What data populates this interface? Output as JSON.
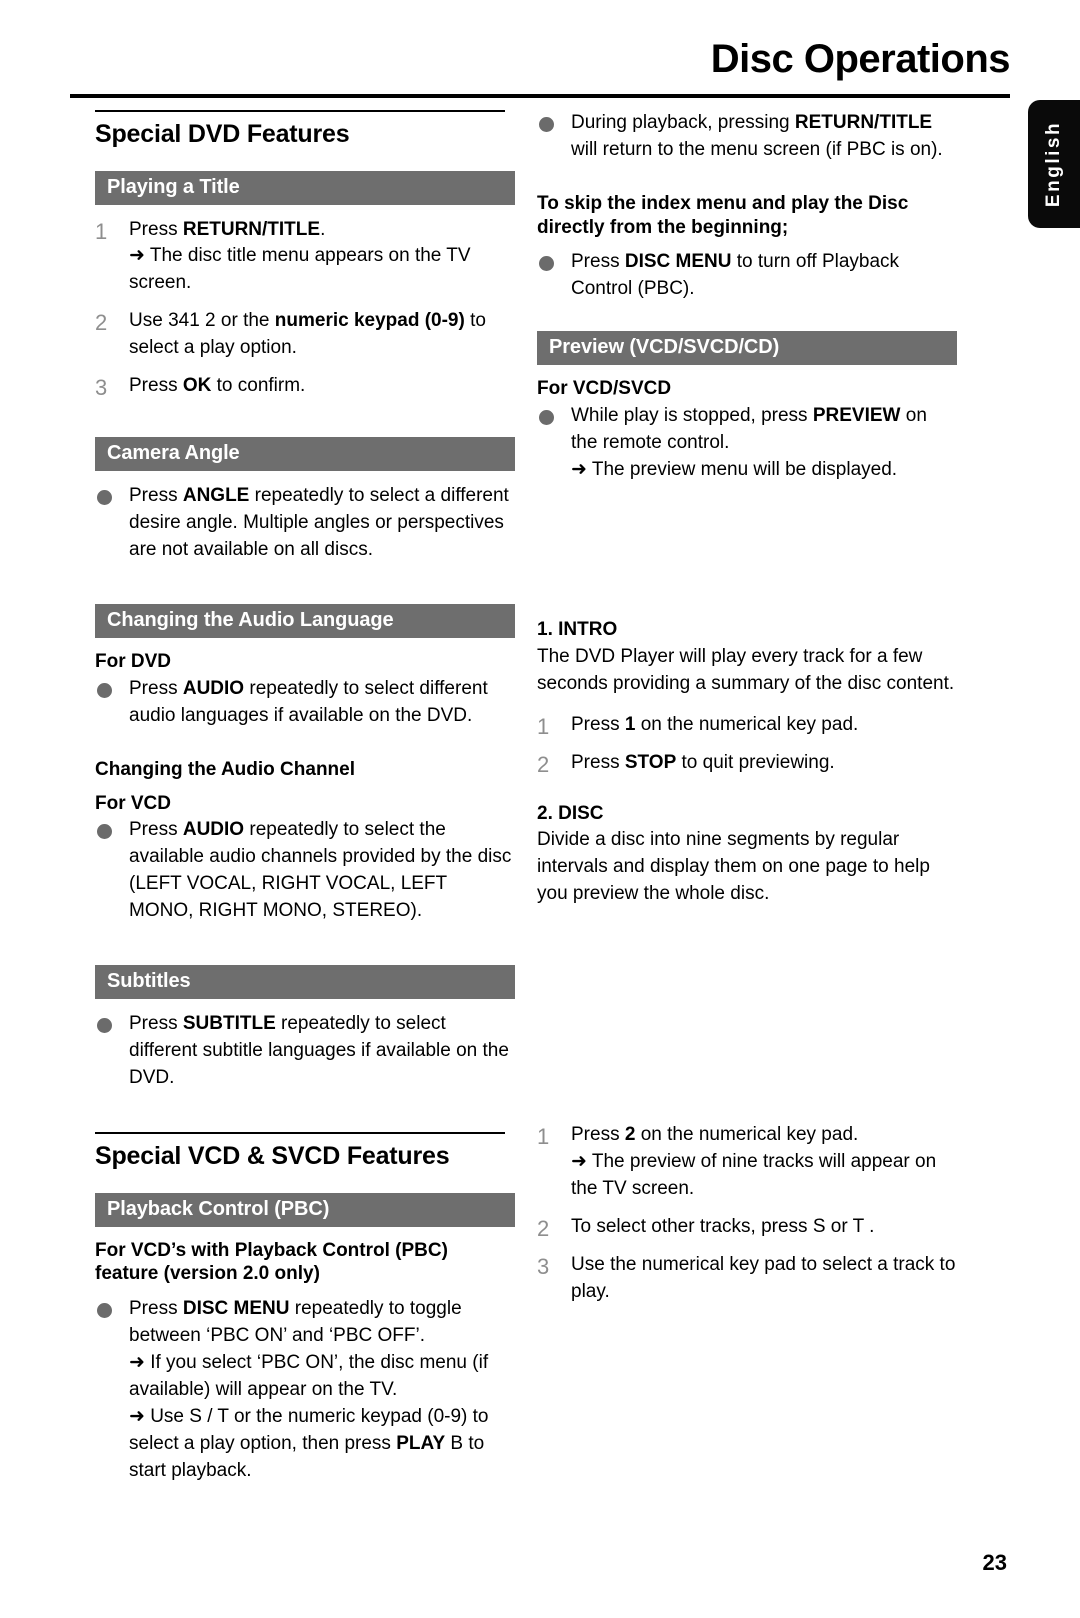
{
  "header": {
    "title": "Disc Operations"
  },
  "language_tab": {
    "label": "English"
  },
  "page_number": "23",
  "left_column": {
    "section_title": "Special DVD Features",
    "playing_a_title": {
      "band": "Playing a Title",
      "steps": [
        {
          "num": "1",
          "line1_pre": "Press ",
          "line1_bold": "RETURN/TITLE",
          "line1_post": ".",
          "arrow": "➜ The disc title menu appears on the TV screen."
        },
        {
          "num": "2",
          "line1_pre": "Use 341 2    or the ",
          "line1_bold": "numeric keypad (0-9)",
          "line1_post": " to select a play option."
        },
        {
          "num": "3",
          "line1_pre": "Press ",
          "line1_bold": "OK",
          "line1_post": " to confirm."
        }
      ]
    },
    "camera_angle": {
      "band": "Camera Angle",
      "bullet_pre": "Press ",
      "bullet_bold": "ANGLE",
      "bullet_post": " repeatedly to select a different desire angle. Multiple angles or perspectives are not available on all discs."
    },
    "audio_language": {
      "band": "Changing the Audio Language",
      "subhead": "For DVD",
      "bullet_pre": "Press ",
      "bullet_bold": "AUDIO",
      "bullet_post": " repeatedly to select different audio languages if available on the DVD."
    },
    "audio_channel": {
      "heading": "Changing the Audio Channel",
      "subhead": "For VCD",
      "bullet_pre": "Press ",
      "bullet_bold": "AUDIO",
      "bullet_post": " repeatedly to select the available audio channels provided by the disc (LEFT VOCAL, RIGHT VOCAL, LEFT MONO, RIGHT MONO, STEREO)."
    },
    "subtitles": {
      "band": "Subtitles",
      "bullet_pre": "Press ",
      "bullet_bold": "SUBTITLE",
      "bullet_post": " repeatedly to select different subtitle languages if available on the DVD."
    },
    "vcd_section_title": "Special VCD & SVCD Features",
    "playback_control": {
      "band": "Playback Control (PBC)",
      "subhead": "For VCD’s with Playback Control (PBC) feature (version 2.0 only)",
      "bullet_pre": "Press ",
      "bullet_bold": "DISC MENU",
      "bullet_post": " repeatedly to toggle between ‘PBC ON’ and ‘PBC OFF’.",
      "arrow1": "➜ If you select ‘PBC ON’, the disc menu (if available) will appear on the TV.",
      "arrow2_pre": "➜ Use S    / T    or the numeric keypad (0-9) to select a play option, then press ",
      "arrow2_bold": "PLAY",
      "arrow2_post": " B  to start playback."
    }
  },
  "right_column": {
    "return_title_bullet": {
      "pre": "During playback, pressing ",
      "bold1": "RETURN/TITLE",
      "post": " will return to the menu screen (if PBC is on)."
    },
    "skip_index": {
      "heading": "To skip the index menu and play the Disc directly from the beginning;",
      "bullet_pre": "Press ",
      "bullet_bold": "DISC MENU",
      "bullet_post": " to turn off Playback Control (PBC)."
    },
    "preview": {
      "band": "Preview (VCD/SVCD/CD)",
      "subhead": "For VCD/SVCD",
      "bullet_pre": "While play is stopped, press ",
      "bullet_bold": "PREVIEW",
      "bullet_post": " on the remote control.",
      "arrow": "➜ The preview menu will be displayed."
    },
    "intro": {
      "heading": "1. INTRO",
      "body": "The DVD Player will play every track for a few seconds providing a summary of the disc content.",
      "steps": [
        {
          "num": "1",
          "pre": "Press ",
          "bold": "1",
          "post": " on the numerical key pad."
        },
        {
          "num": "2",
          "pre": "Press ",
          "bold": "STOP",
          "post": " to quit previewing."
        }
      ]
    },
    "disc": {
      "heading": "2. DISC",
      "body": "Divide a disc into nine segments by regular intervals and display them on one page to help you preview the whole disc.",
      "steps": [
        {
          "num": "1",
          "pre": "Press ",
          "bold": "2",
          "post": " on the numerical key pad.",
          "arrow": "➜ The preview of nine tracks will appear on the TV screen."
        },
        {
          "num": "2",
          "pre": "To select other tracks, press S    or T   .",
          "bold": "",
          "post": ""
        },
        {
          "num": "3",
          "pre": "Use the numerical key pad to select a track to play.",
          "bold": "",
          "post": ""
        }
      ]
    }
  }
}
